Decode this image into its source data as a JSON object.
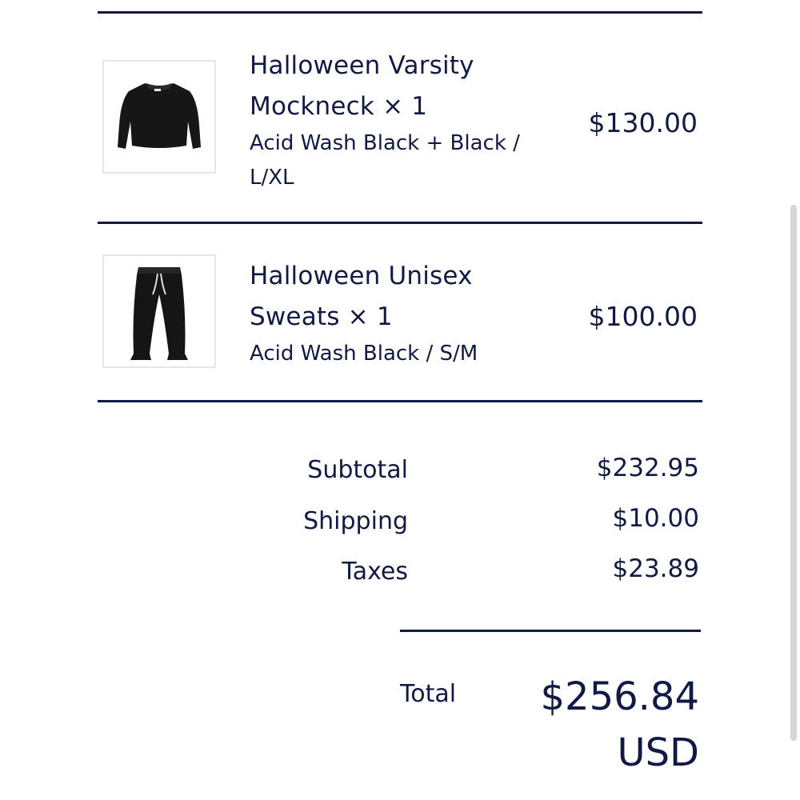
{
  "items": [
    {
      "title_line1": "Halloween Varsity",
      "title_line2": "Mockneck × 1",
      "variant_line1": "Acid Wash Black + Black /",
      "variant_line2": "L/XL",
      "price": "$130.00",
      "image_icon": "sweatshirt-icon"
    },
    {
      "title_line1": "Halloween Unisex",
      "title_line2": "Sweats × 1",
      "variant_line1": "Acid Wash Black / S/M",
      "price": "$100.00",
      "image_icon": "sweatpants-icon"
    }
  ],
  "summary": {
    "subtotal_label": "Subtotal",
    "subtotal_value": "$232.95",
    "shipping_label": "Shipping",
    "shipping_value": "$10.00",
    "taxes_label": "Taxes",
    "taxes_value": "$23.89"
  },
  "total": {
    "label": "Total",
    "amount": "$256.84",
    "currency": "USD"
  },
  "colors": {
    "text": "#111a45",
    "divider": "#111a45",
    "thumb_border": "#e6e6e6"
  }
}
